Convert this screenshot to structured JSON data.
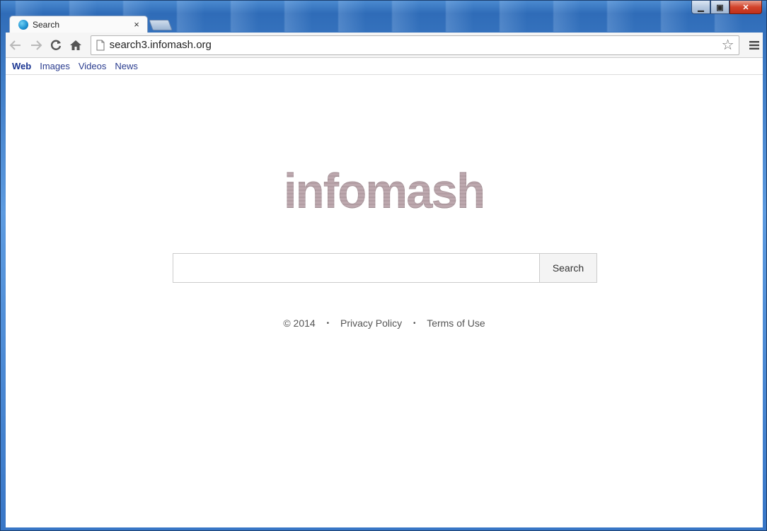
{
  "browser": {
    "tab": {
      "title": "Search",
      "close_glyph": "×"
    },
    "caption_buttons": {
      "minimize": "▁",
      "maximize": "▣",
      "close": "✕"
    },
    "toolbar": {
      "back_icon": "back-arrow-icon",
      "forward_icon": "forward-arrow-icon",
      "reload_icon": "reload-icon",
      "home_icon": "home-icon",
      "url": "search3.infomash.org",
      "star_glyph": "☆",
      "menu_glyph": "≡"
    }
  },
  "page": {
    "nav": [
      {
        "label": "Web",
        "active": true
      },
      {
        "label": "Images",
        "active": false
      },
      {
        "label": "Videos",
        "active": false
      },
      {
        "label": "News",
        "active": false
      }
    ],
    "logo_text": "infomash",
    "search": {
      "input_value": "",
      "button_label": "Search"
    },
    "footer": {
      "copyright": "© 2014",
      "separator": "•",
      "privacy": "Privacy Policy",
      "terms": "Terms of Use"
    }
  },
  "colors": {
    "nav_link": "#2a3c8f",
    "frame_blue": "#2f6cb8",
    "close_red": "#d2432a"
  }
}
